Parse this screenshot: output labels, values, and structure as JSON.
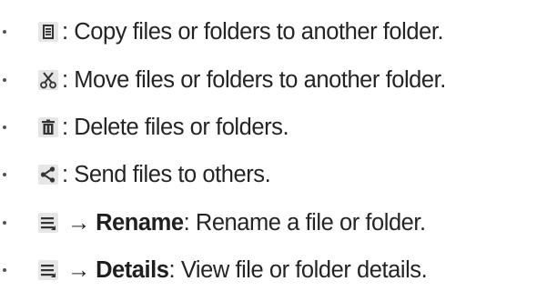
{
  "items": [
    {
      "icon": "copy-icon",
      "text": ": Copy files or folders to another folder."
    },
    {
      "icon": "cut-scissors-icon",
      "text": ": Move files or folders to another folder."
    },
    {
      "icon": "trash-icon",
      "text": ": Delete files or folders."
    },
    {
      "icon": "share-icon",
      "text": ": Send files to others."
    },
    {
      "icon": "menu-icon",
      "arrow": "→",
      "bold": "Rename",
      "text": ": Rename a file or folder."
    },
    {
      "icon": "menu-icon",
      "arrow": "→",
      "bold": "Details",
      "text": ": View file or folder details."
    }
  ]
}
